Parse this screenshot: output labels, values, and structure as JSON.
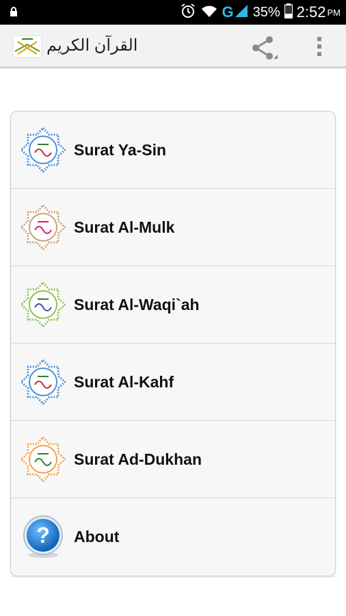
{
  "status_bar": {
    "network": "G",
    "battery_percent": "35%",
    "time": "2:52",
    "ampm": "PM"
  },
  "action_bar": {
    "title": "القرآن الكريم",
    "share_icon": "share-icon",
    "overflow_icon": "overflow-menu-icon"
  },
  "menu": {
    "items": [
      {
        "label": "Surat Ya-Sin",
        "icon": "surah-emblem-icon",
        "color": "#4a90d9"
      },
      {
        "label": "Surat Al-Mulk",
        "icon": "surah-emblem-icon",
        "color": "#c9a27a"
      },
      {
        "label": "Surat Al-Waqi`ah",
        "icon": "surah-emblem-icon",
        "color": "#8cc152"
      },
      {
        "label": "Surat Al-Kahf",
        "icon": "surah-emblem-icon",
        "color": "#4a90d9"
      },
      {
        "label": "Surat Ad-Dukhan",
        "icon": "surah-emblem-icon",
        "color": "#f0a24a"
      },
      {
        "label": "About",
        "icon": "help-question-icon",
        "color": "#1e88e5"
      }
    ]
  }
}
